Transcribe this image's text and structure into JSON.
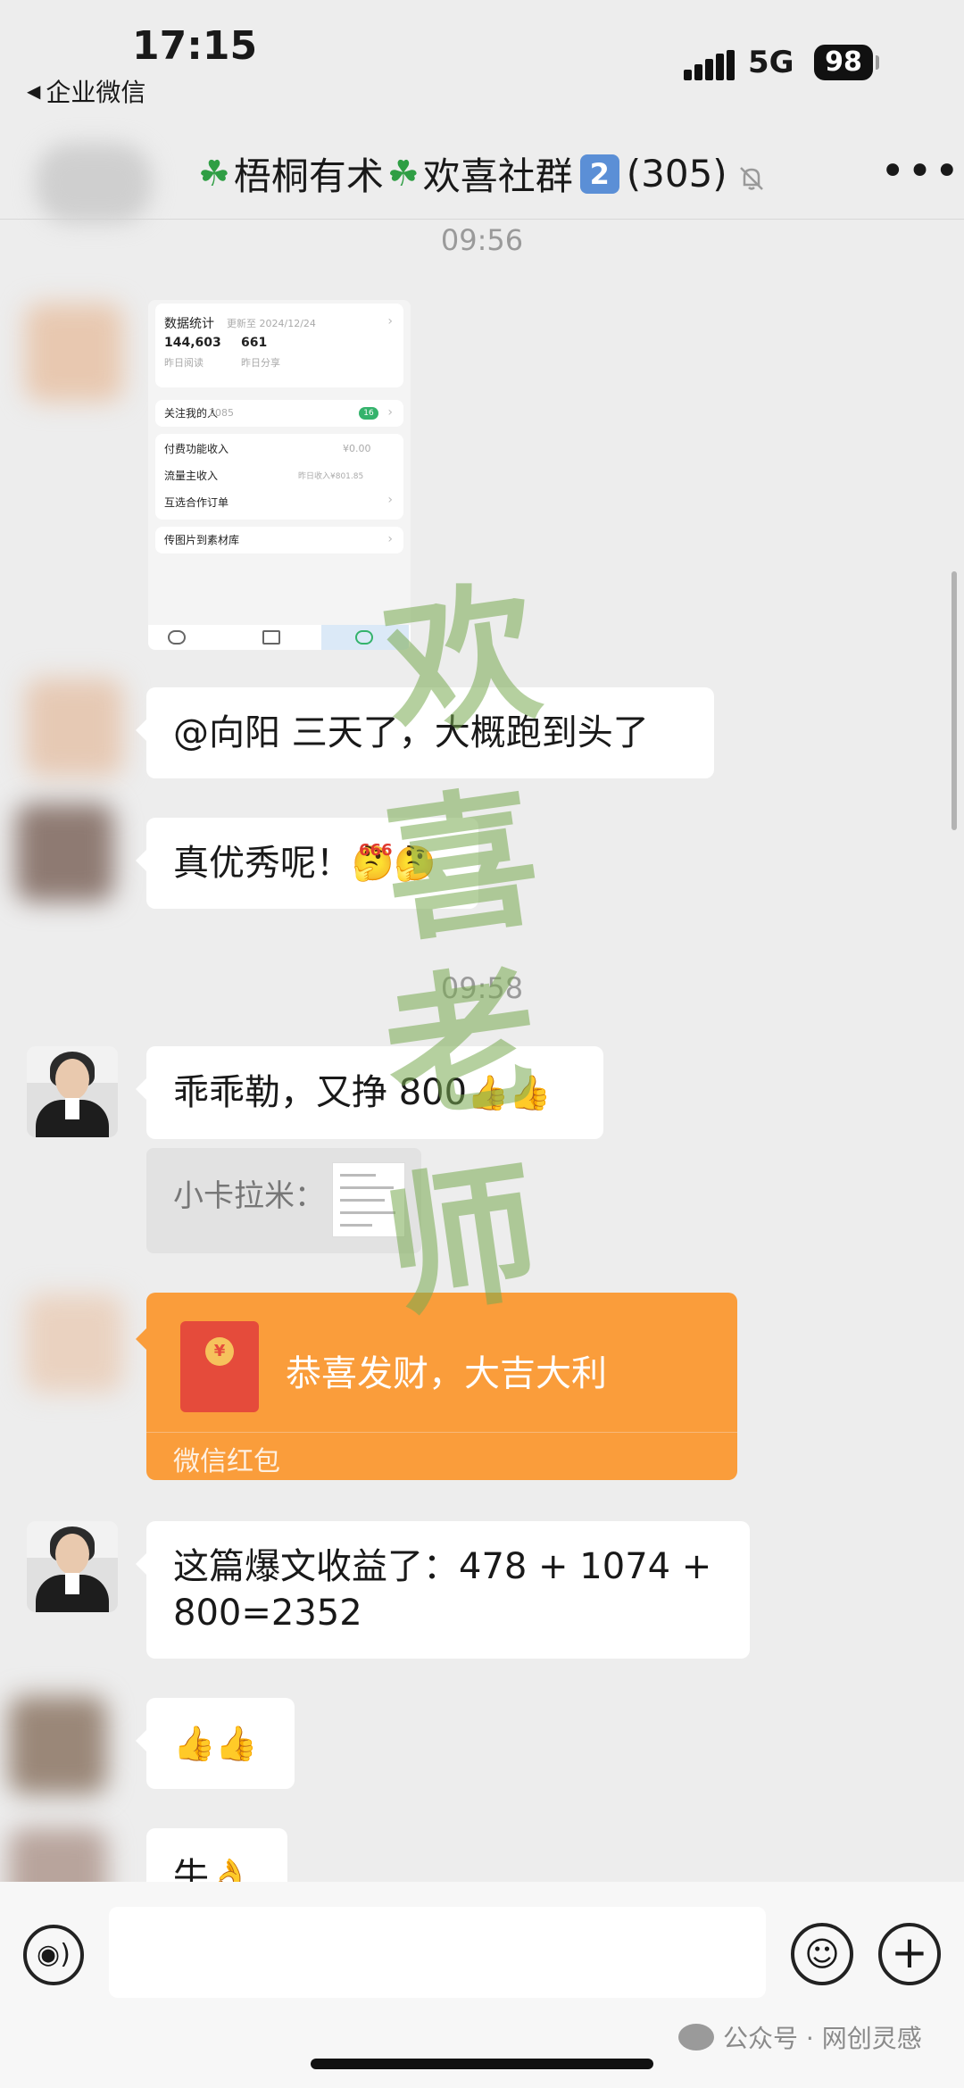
{
  "status_bar": {
    "time": "17:15",
    "back_app": "企业微信",
    "network": "5G",
    "battery": "98"
  },
  "nav": {
    "title_prefix": "梧桐有术",
    "title_middle": "欢喜社群",
    "group_number": "2",
    "member_count": "(305)"
  },
  "timestamps": [
    "09:56",
    "09:58"
  ],
  "screenshot_card": {
    "stats_title": "数据统计",
    "updated": "更新至 2024/12/24",
    "reads_value": "144,603",
    "reads_label": "昨日阅读",
    "shares_value": "661",
    "shares_label": "昨日分享",
    "followers_label": "关注我的人",
    "followers_count": "2085",
    "followers_badge": "16",
    "paid_label": "付费功能收入",
    "paid_value": "¥0.00",
    "traffic_label": "流量主收入",
    "traffic_value": "昨日收入¥801.85",
    "cooperation_label": "互选合作订单",
    "upload_label": "传图片到素材库"
  },
  "messages": {
    "m1": "@向阳 三天了，大概跑到头了",
    "m2_text": "真优秀呢！",
    "m2_emoji": "🤔🤔",
    "m2_emoji_tag": "666",
    "m3_text": "乖乖勒，又挣 800",
    "m3_emoji": "👍👍",
    "quote_text": "小卡拉米：",
    "red_packet_title": "恭喜发财，大吉大利",
    "red_packet_label": "微信红包",
    "m5_line1": "这篇爆文收益了：478 + 1074 +",
    "m5_line2": "800=2352",
    "m6": "👍👍",
    "m7_text": "牛",
    "m7_emoji": "👌"
  },
  "watermark": [
    "欢",
    "喜",
    "老",
    "师"
  ],
  "footer": {
    "source": "公众号 · 网创灵感"
  }
}
